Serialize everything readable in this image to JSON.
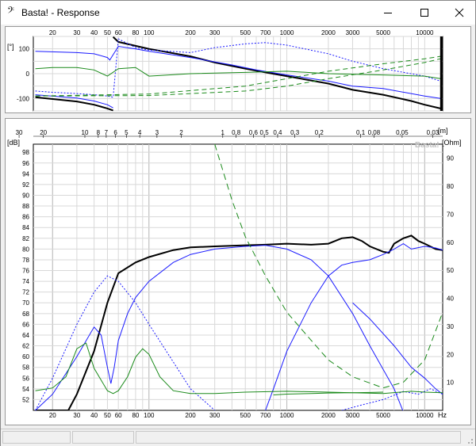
{
  "window": {
    "icon_glyph": "𝄢",
    "title": "Basta! - Response",
    "minimize_icon": "minimize-icon",
    "maximize_icon": "maximize-icon",
    "close_icon": "close-icon"
  },
  "phase_plot": {
    "unit_label": "[°]",
    "freq_ticks": [
      "20",
      "30",
      "40",
      "50",
      "60",
      "80",
      "100",
      "200",
      "300",
      "500",
      "700",
      "1000",
      "2000",
      "3000",
      "5000",
      "10000"
    ],
    "y_ticks": [
      "100",
      "0",
      "-100"
    ]
  },
  "response_plot": {
    "watermark": "Basta!",
    "left_unit": "[dB]",
    "right_unit": "[Ohm]",
    "top_unit": "[m]",
    "bottom_unit": "Hz",
    "wavelength_ticks": [
      "30",
      "20",
      "10",
      "8",
      "7",
      "6",
      "5",
      "4",
      "3",
      "2",
      "1",
      "0,8",
      "0,6",
      "0,5",
      "0,4",
      "0,3",
      "0,2",
      "0,1",
      "0,08",
      "0,05",
      "0,03"
    ],
    "db_ticks": [
      "98",
      "96",
      "94",
      "92",
      "90",
      "88",
      "86",
      "84",
      "82",
      "80",
      "78",
      "76",
      "74",
      "72",
      "70",
      "68",
      "66",
      "64",
      "62",
      "60",
      "58",
      "56",
      "54",
      "52"
    ],
    "ohm_ticks": [
      "90",
      "80",
      "70",
      "60",
      "50",
      "40",
      "30",
      "20",
      "10"
    ],
    "freq_ticks": [
      "20",
      "30",
      "40",
      "50",
      "60",
      "80",
      "100",
      "200",
      "300",
      "500",
      "700",
      "1000",
      "2000",
      "3000",
      "5000",
      "10000"
    ]
  },
  "colors": {
    "black": "#000000",
    "blue": "#1a1aff",
    "green": "#1a8a1a",
    "grid": "#d8d8d8",
    "grid_major": "#bdbdbd"
  }
}
